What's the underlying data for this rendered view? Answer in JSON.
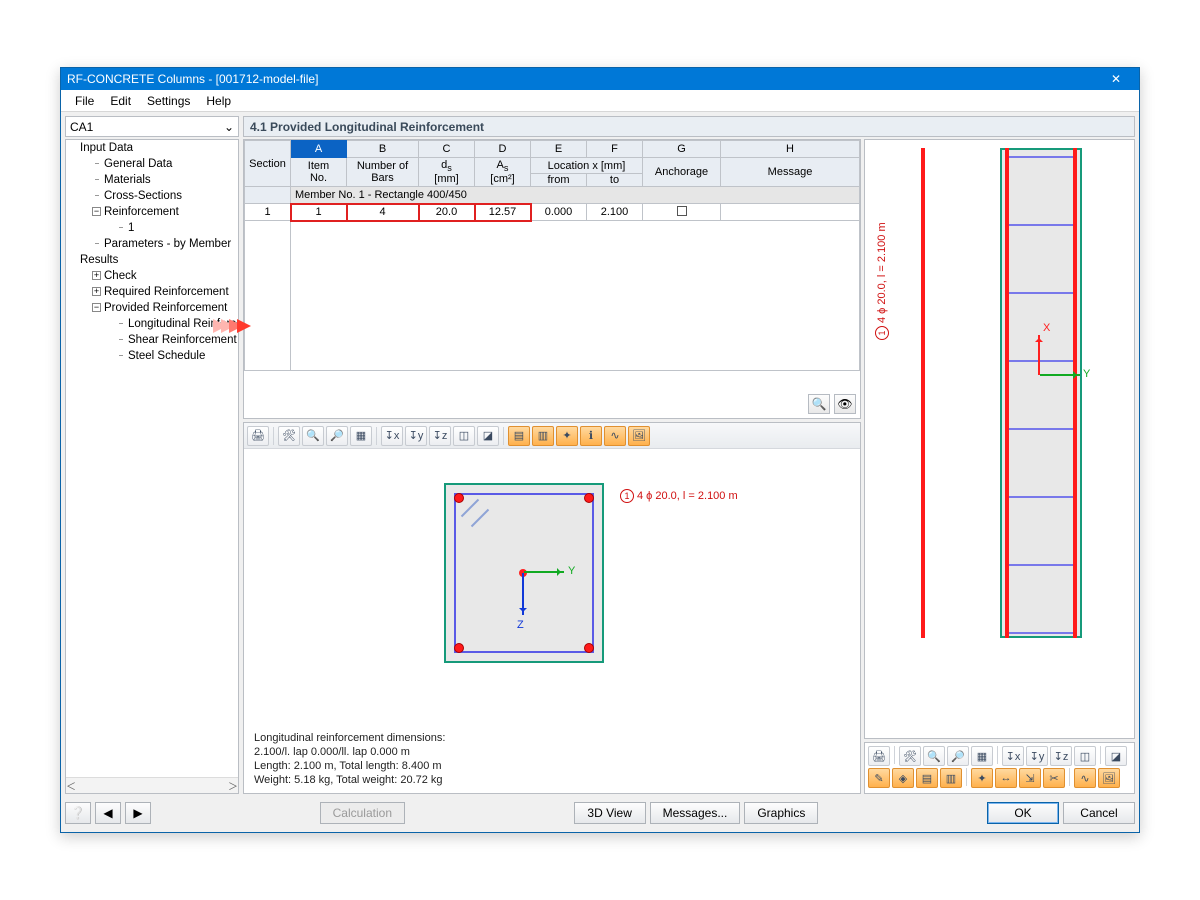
{
  "window": {
    "title": "RF-CONCRETE Columns - [001712-model-file]"
  },
  "menu": {
    "file": "File",
    "edit": "Edit",
    "settings": "Settings",
    "help": "Help"
  },
  "case_selector": "CA1",
  "tree": {
    "input": "Input Data",
    "general": "General Data",
    "materials": "Materials",
    "xsec": "Cross-Sections",
    "reinf": "Reinforcement",
    "reinf1": "1",
    "params": "Parameters - by Member",
    "results": "Results",
    "check": "Check",
    "reqreinf": "Required Reinforcement",
    "provreinf": "Provided Reinforcement",
    "long": "Longitudinal Reinforcement",
    "shear": "Shear Reinforcement",
    "schedule": "Steel Schedule"
  },
  "panel_title": "4.1 Provided Longitudinal Reinforcement",
  "grid": {
    "cols": {
      "A": "A",
      "B": "B",
      "C": "C",
      "D": "D",
      "E": "E",
      "F": "F",
      "G": "G",
      "H": "H"
    },
    "h_section": "Section",
    "h_item": "Item\nNo.",
    "h_bars": "Number of\nBars",
    "h_ds1": "d",
    "h_ds2": "s",
    "h_ds_unit": "[mm]",
    "h_as1": "A",
    "h_as2": "s",
    "h_as_unit": "[cm²]",
    "h_loc": "Location x [mm]",
    "h_from": "from",
    "h_to": "to",
    "h_anch": "Anchorage",
    "h_msg": "Message",
    "member_row": "Member No. 1 - Rectangle 400/450",
    "row1": {
      "sec": "1",
      "item": "1",
      "bars": "4",
      "ds": "20.0",
      "as": "12.57",
      "from": "0.000",
      "to": "2.100"
    }
  },
  "callout": {
    "num": "1",
    "text": "4 ϕ 20.0, l = 2.100 m"
  },
  "axis": {
    "y": "Y",
    "z": "Z",
    "x": "X"
  },
  "dims": {
    "l1": "Longitudinal reinforcement dimensions:",
    "l2": "2.100/l. lap 0.000/ll. lap 0.000 m",
    "l3": "Length: 2.100 m, Total length: 8.400 m",
    "l4": "Weight: 5.18 kg, Total weight: 20.72 kg"
  },
  "footer": {
    "calc": "Calculation",
    "view3d": "3D View",
    "messages": "Messages...",
    "graphics": "Graphics",
    "ok": "OK",
    "cancel": "Cancel"
  }
}
